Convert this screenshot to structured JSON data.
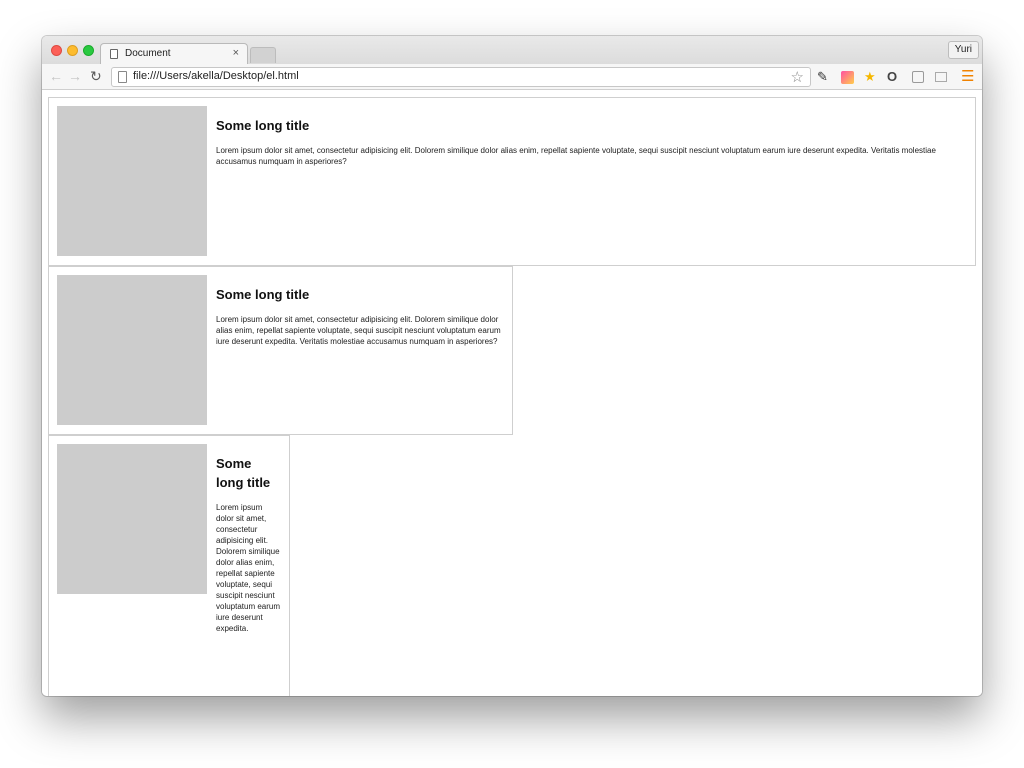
{
  "window": {
    "tab": {
      "title": "Document",
      "close_label": "×"
    },
    "profile_label": "Yuri"
  },
  "toolbar": {
    "url": "file:///Users/akella/Desktop/el.html"
  },
  "icons": {
    "back": "back-arrow-icon",
    "forward": "forward-arrow-icon",
    "reload": "reload-icon",
    "bookmark": "star-outline-icon",
    "menu": "hamburger-menu-icon"
  },
  "colors": {
    "thumb": "#cccccc",
    "menu_accent": "#f08200"
  },
  "cards": [
    {
      "title": "Some long title",
      "text": "Lorem ipsum dolor sit amet, consectetur adipisicing elit. Dolorem similique dolor alias enim, repellat sapiente voluptate, sequi suscipit nesciunt voluptatum earum iure deserunt expedita. Veritatis molestiae accusamus numquam in asperiores?"
    },
    {
      "title": "Some long title",
      "text": "Lorem ipsum dolor sit amet, consectetur adipisicing elit. Dolorem similique dolor alias enim, repellat sapiente voluptate, sequi suscipit nesciunt voluptatum earum iure deserunt expedita. Veritatis molestiae accusamus numquam in asperiores?"
    },
    {
      "title": "Some long title",
      "text": "Lorem ipsum dolor sit amet, consectetur adipisicing elit. Dolorem similique dolor alias enim, repellat sapiente voluptate, sequi suscipit nesciunt voluptatum earum iure deserunt expedita."
    }
  ]
}
